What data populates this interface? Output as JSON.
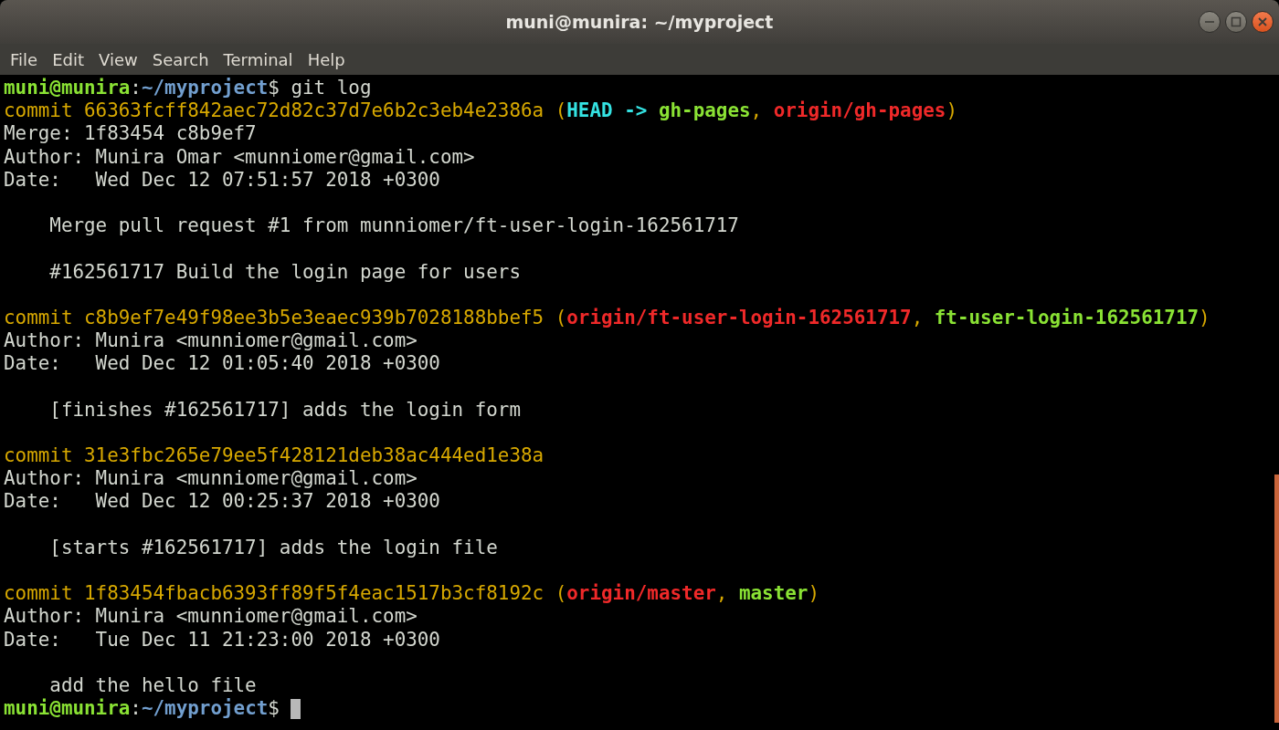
{
  "window": {
    "title": "muni@munira: ~/myproject"
  },
  "menu": [
    "File",
    "Edit",
    "View",
    "Search",
    "Terminal",
    "Help"
  ],
  "terminal": {
    "lines": [
      {
        "kind": "text",
        "segments": [
          {
            "kind": "user",
            "text": "muni@munira"
          },
          {
            "kind": "plain",
            "text": ":"
          },
          {
            "kind": "path",
            "text": "~/myproject"
          },
          {
            "kind": "plain",
            "text": "$ git log"
          }
        ]
      },
      {
        "kind": "text",
        "segments": [
          {
            "kind": "hash",
            "text": "commit 66363fcff842aec72d82c37d7e6b2c3eb4e2386a ("
          },
          {
            "kind": "head",
            "text": "HEAD -> "
          },
          {
            "kind": "local",
            "text": "gh-pages"
          },
          {
            "kind": "hash",
            "text": ", "
          },
          {
            "kind": "remote",
            "text": "origin/gh-pages"
          },
          {
            "kind": "hash",
            "text": ")"
          }
        ]
      },
      {
        "kind": "text",
        "segments": [
          {
            "kind": "plain",
            "text": "Merge: 1f83454 c8b9ef7"
          }
        ]
      },
      {
        "kind": "text",
        "segments": [
          {
            "kind": "plain",
            "text": "Author: Munira Omar <munniomer@gmail.com>"
          }
        ]
      },
      {
        "kind": "text",
        "segments": [
          {
            "kind": "plain",
            "text": "Date:   Wed Dec 12 07:51:57 2018 +0300"
          }
        ]
      },
      {
        "kind": "blank"
      },
      {
        "kind": "text",
        "segments": [
          {
            "kind": "plain",
            "text": "    Merge pull request #1 from munniomer/ft-user-login-162561717"
          }
        ]
      },
      {
        "kind": "blank"
      },
      {
        "kind": "text",
        "segments": [
          {
            "kind": "plain",
            "text": "    #162561717 Build the login page for users"
          }
        ]
      },
      {
        "kind": "blank"
      },
      {
        "kind": "text",
        "segments": [
          {
            "kind": "hash",
            "text": "commit c8b9ef7e49f98ee3b5e3eaec939b7028188bbef5 ("
          },
          {
            "kind": "remote",
            "text": "origin/ft-user-login-162561717"
          },
          {
            "kind": "hash",
            "text": ", "
          },
          {
            "kind": "local",
            "text": "ft-user-login-162561717"
          },
          {
            "kind": "hash",
            "text": ")"
          }
        ]
      },
      {
        "kind": "text",
        "segments": [
          {
            "kind": "plain",
            "text": "Author: Munira <munniomer@gmail.com>"
          }
        ]
      },
      {
        "kind": "text",
        "segments": [
          {
            "kind": "plain",
            "text": "Date:   Wed Dec 12 01:05:40 2018 +0300"
          }
        ]
      },
      {
        "kind": "blank"
      },
      {
        "kind": "text",
        "segments": [
          {
            "kind": "plain",
            "text": "    [finishes #162561717] adds the login form"
          }
        ]
      },
      {
        "kind": "blank"
      },
      {
        "kind": "text",
        "segments": [
          {
            "kind": "hash",
            "text": "commit 31e3fbc265e79ee5f428121deb38ac444ed1e38a"
          }
        ]
      },
      {
        "kind": "text",
        "segments": [
          {
            "kind": "plain",
            "text": "Author: Munira <munniomer@gmail.com>"
          }
        ]
      },
      {
        "kind": "text",
        "segments": [
          {
            "kind": "plain",
            "text": "Date:   Wed Dec 12 00:25:37 2018 +0300"
          }
        ]
      },
      {
        "kind": "blank"
      },
      {
        "kind": "text",
        "segments": [
          {
            "kind": "plain",
            "text": "    [starts #162561717] adds the login file"
          }
        ]
      },
      {
        "kind": "blank"
      },
      {
        "kind": "text",
        "segments": [
          {
            "kind": "hash",
            "text": "commit 1f83454fbacb6393ff89f5f4eac1517b3cf8192c ("
          },
          {
            "kind": "remote",
            "text": "origin/master"
          },
          {
            "kind": "hash",
            "text": ", "
          },
          {
            "kind": "local",
            "text": "master"
          },
          {
            "kind": "hash",
            "text": ")"
          }
        ]
      },
      {
        "kind": "text",
        "segments": [
          {
            "kind": "plain",
            "text": "Author: Munira <munniomer@gmail.com>"
          }
        ]
      },
      {
        "kind": "text",
        "segments": [
          {
            "kind": "plain",
            "text": "Date:   Tue Dec 11 21:23:00 2018 +0300"
          }
        ]
      },
      {
        "kind": "blank"
      },
      {
        "kind": "text",
        "segments": [
          {
            "kind": "plain",
            "text": "    add the hello file"
          }
        ]
      },
      {
        "kind": "prompt",
        "segments": [
          {
            "kind": "user",
            "text": "muni@munira"
          },
          {
            "kind": "plain",
            "text": ":"
          },
          {
            "kind": "path",
            "text": "~/myproject"
          },
          {
            "kind": "plain",
            "text": "$ "
          }
        ]
      }
    ]
  }
}
